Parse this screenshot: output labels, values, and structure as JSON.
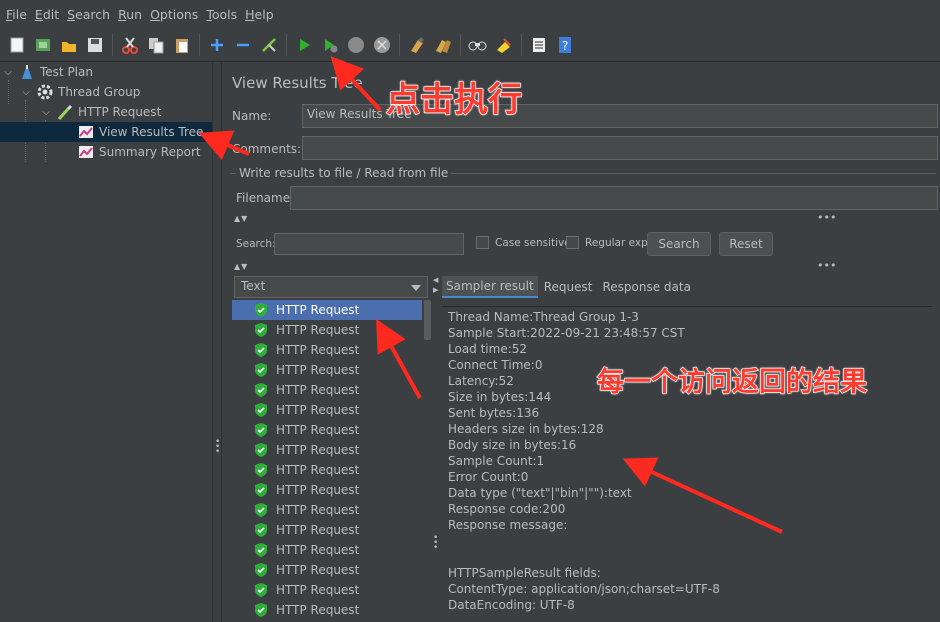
{
  "menu": [
    {
      "ul": "F",
      "rest": "ile"
    },
    {
      "ul": "E",
      "rest": "dit"
    },
    {
      "ul": "S",
      "rest": "earch"
    },
    {
      "ul": "R",
      "rest": "un"
    },
    {
      "ul": "O",
      "rest": "ptions"
    },
    {
      "ul": "T",
      "rest": "ools"
    },
    {
      "ul": "H",
      "rest": "elp"
    }
  ],
  "tree": {
    "test_plan": "Test Plan",
    "thread_group": "Thread Group",
    "http_request": "HTTP Request",
    "view_results_tree": "View Results Tree",
    "summary_report": "Summary Report"
  },
  "panel": {
    "title": "View Results Tree",
    "name_label": "Name:",
    "name_value": "View Results Tree",
    "comments_label": "Comments:",
    "write_results_label": "Write results to file / Read from file",
    "filename_label": "Filename",
    "search_label": "Search:",
    "case_sensitive": "Case sensitive",
    "regular_exp": "Regular exp.",
    "search_button": "Search",
    "reset_button": "Reset",
    "renderer": "Text"
  },
  "results": [
    "HTTP Request",
    "HTTP Request",
    "HTTP Request",
    "HTTP Request",
    "HTTP Request",
    "HTTP Request",
    "HTTP Request",
    "HTTP Request",
    "HTTP Request",
    "HTTP Request",
    "HTTP Request",
    "HTTP Request",
    "HTTP Request",
    "HTTP Request",
    "HTTP Request",
    "HTTP Request"
  ],
  "tabs": [
    "Sampler result",
    "Request",
    "Response data"
  ],
  "sampler_lines": [
    "Thread Name:Thread Group 1-3",
    "Sample Start:2022-09-21 23:48:57 CST",
    "Load time:52",
    "Connect Time:0",
    "Latency:52",
    "Size in bytes:144",
    "Sent bytes:136",
    "Headers size in bytes:128",
    "Body size in bytes:16",
    "Sample Count:1",
    "Error Count:0",
    "Data type (\"text\"|\"bin\"|\"\"):text",
    "Response code:200",
    "Response message:",
    "",
    "",
    "HTTPSampleResult fields:",
    "ContentType: application/json;charset=UTF-8",
    "DataEncoding: UTF-8"
  ],
  "annotations": {
    "run_hint": "点击执行",
    "result_hint": "每一个访问返回的结果"
  },
  "colors": {
    "background": "#3c3f41",
    "selection": "#4b6eaf",
    "annotation": "#ff3b2f"
  }
}
